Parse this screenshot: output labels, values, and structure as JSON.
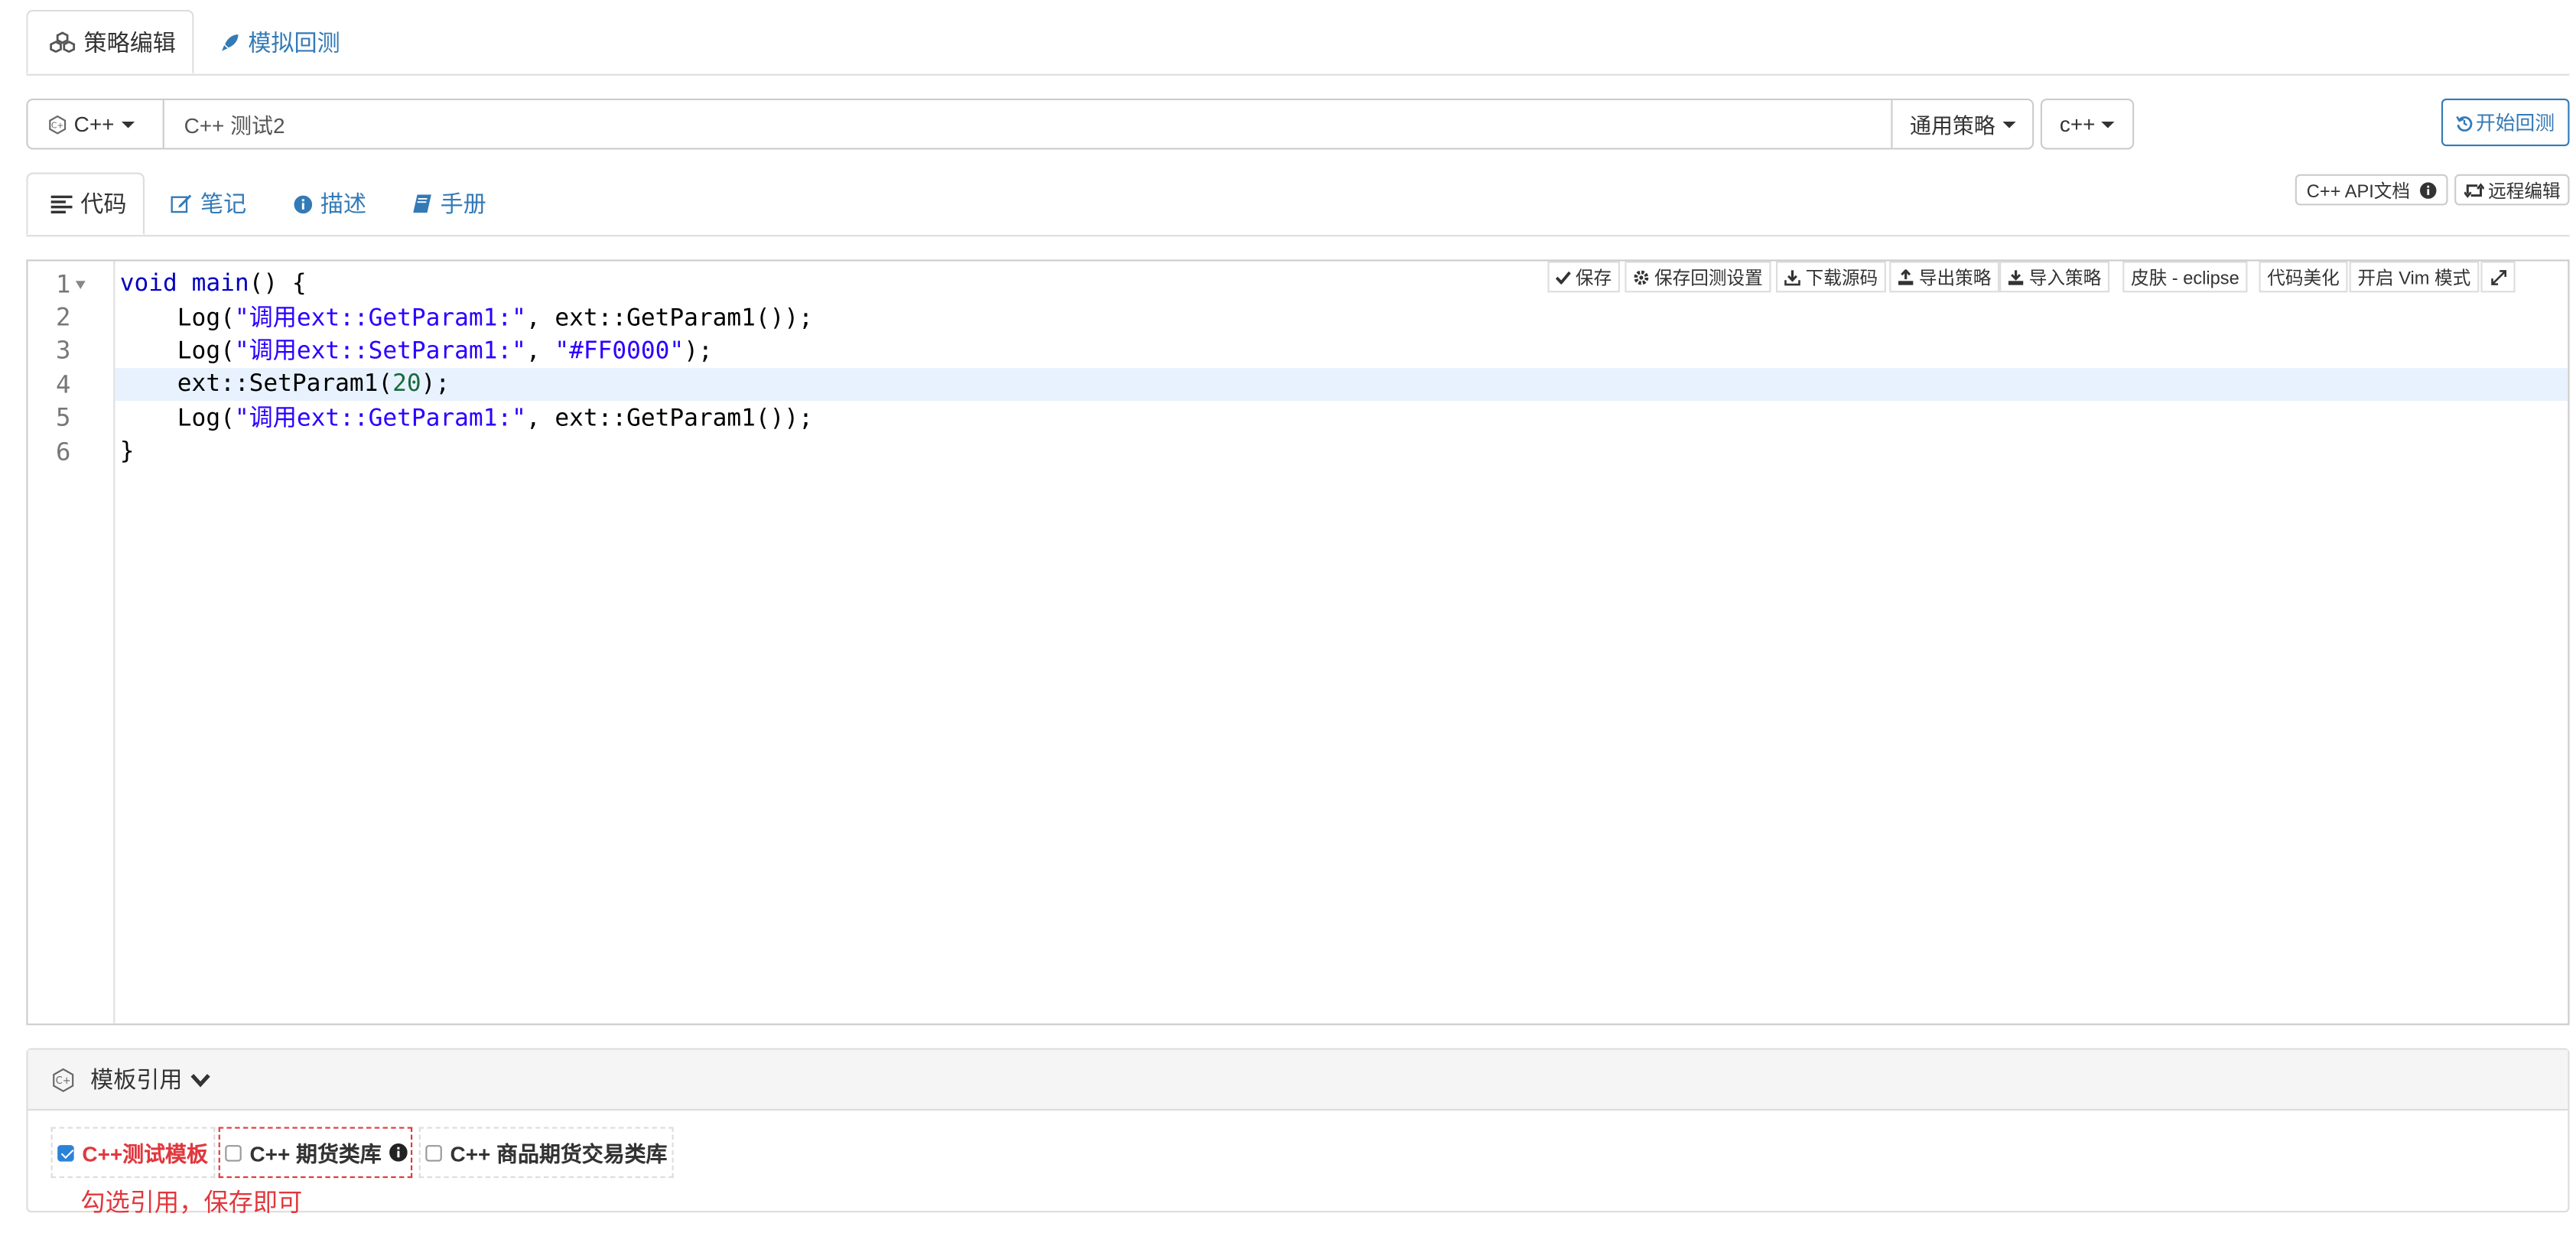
{
  "top_tabs": [
    {
      "label": "策略编辑",
      "icon": "cubes-icon",
      "active": true
    },
    {
      "label": "模拟回测",
      "icon": "rocket-icon",
      "active": false
    }
  ],
  "strategy": {
    "language": "C++",
    "name": "C++ 测试2",
    "category": "通用策略",
    "version": "c++",
    "start_backtest": "开始回测"
  },
  "code_tabs": [
    {
      "label": "代码",
      "icon": "align-left-icon",
      "active": true
    },
    {
      "label": "笔记",
      "icon": "edit-icon",
      "active": false
    },
    {
      "label": "描述",
      "icon": "info-circle-icon",
      "active": false
    },
    {
      "label": "手册",
      "icon": "book-icon",
      "active": false
    }
  ],
  "right_buttons": {
    "api_docs": "C++ API文档",
    "remote_edit": "远程编辑"
  },
  "editor_toolbar": [
    {
      "label": "保存",
      "icon": "check-icon"
    },
    {
      "label": "保存回测设置",
      "icon": "gear-icon"
    },
    {
      "label": "下载源码",
      "icon": "download-icon"
    },
    {
      "label": "导出策略",
      "icon": "export-icon"
    },
    {
      "label": "导入策略",
      "icon": "import-icon"
    },
    {
      "label": "皮肤 - eclipse",
      "icon": ""
    },
    {
      "label": "代码美化",
      "icon": ""
    },
    {
      "label": "开启 Vim 模式",
      "icon": ""
    }
  ],
  "code": {
    "line_numbers": [
      "1",
      "2",
      "3",
      "4",
      "5",
      "6"
    ],
    "highlighted_line": 4
  },
  "templates": {
    "header": "模板引用",
    "items": [
      {
        "label": "C++测试模板",
        "checked": true,
        "color": "#e0383e"
      },
      {
        "label": "C++ 期货类库",
        "checked": false,
        "color": "#333333"
      },
      {
        "label": "C++ 商品期货交易类库",
        "checked": false,
        "color": "#333333"
      }
    ],
    "note": "勾选引用，保存即可"
  },
  "colors": {
    "link": "#337ab7",
    "highlight_line": "#e8f2fe",
    "annotation_red": "#e0383e"
  }
}
